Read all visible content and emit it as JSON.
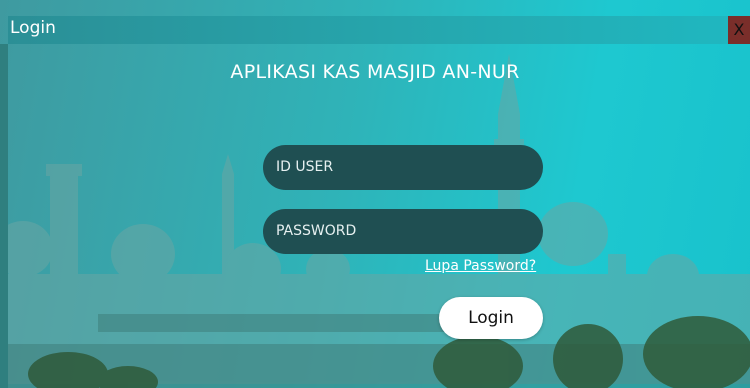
{
  "window": {
    "title": "Login",
    "close_label": "X"
  },
  "app": {
    "title": "APLIKASI KAS MASJID AN-NUR"
  },
  "form": {
    "user_placeholder": "ID USER",
    "password_placeholder": "PASSWORD",
    "forgot_label": "Lupa Password?",
    "login_label": "Login"
  },
  "colors": {
    "field_bg": "#1f4f52",
    "close_bg": "#7a2e2a",
    "accent": "#1ec8d0"
  }
}
